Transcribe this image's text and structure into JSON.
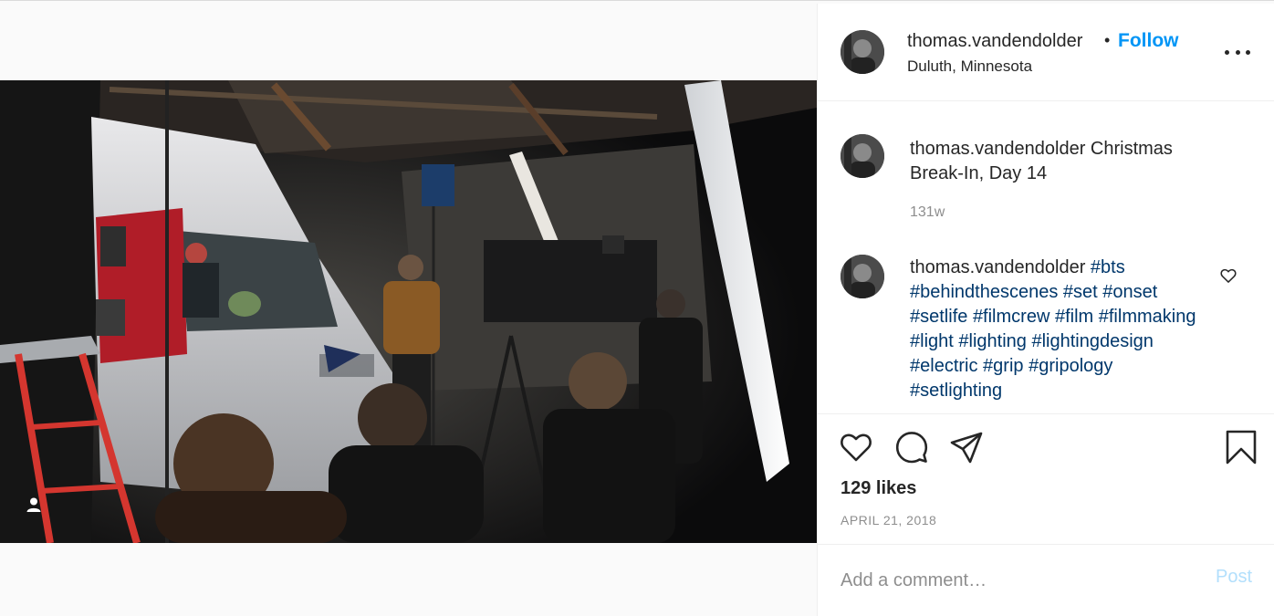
{
  "post": {
    "username": "thomas.vandendolder",
    "separator": "•",
    "follow_label": "Follow",
    "location": "Duluth, Minnesota",
    "more_icon": "more-options-icon"
  },
  "caption": {
    "username": "thomas.vandendolder",
    "text": "Christmas Break-In, Day 14",
    "time": "131w"
  },
  "comment": {
    "username": "thomas.vandendolder",
    "hashtags": [
      "#bts",
      "#behindthescenes",
      "#set",
      "#onset",
      "#setlife",
      "#filmcrew",
      "#film",
      "#filmmaking",
      "#light",
      "#lighting",
      "#lightingdesign",
      "#electric",
      "#grip",
      "#gripology",
      "#setlighting"
    ]
  },
  "actions": {
    "like_icon": "heart-icon",
    "comment_icon": "comment-icon",
    "share_icon": "share-icon",
    "save_icon": "bookmark-icon",
    "likes": "129 likes",
    "date": "APRIL 21, 2018"
  },
  "add_comment": {
    "placeholder": "Add a comment…",
    "post_label": "Post"
  },
  "colors": {
    "follow": "#0095f6",
    "hashtag": "#00376b",
    "post_disabled": "#b2dffc",
    "muted": "#8e8e8e"
  }
}
